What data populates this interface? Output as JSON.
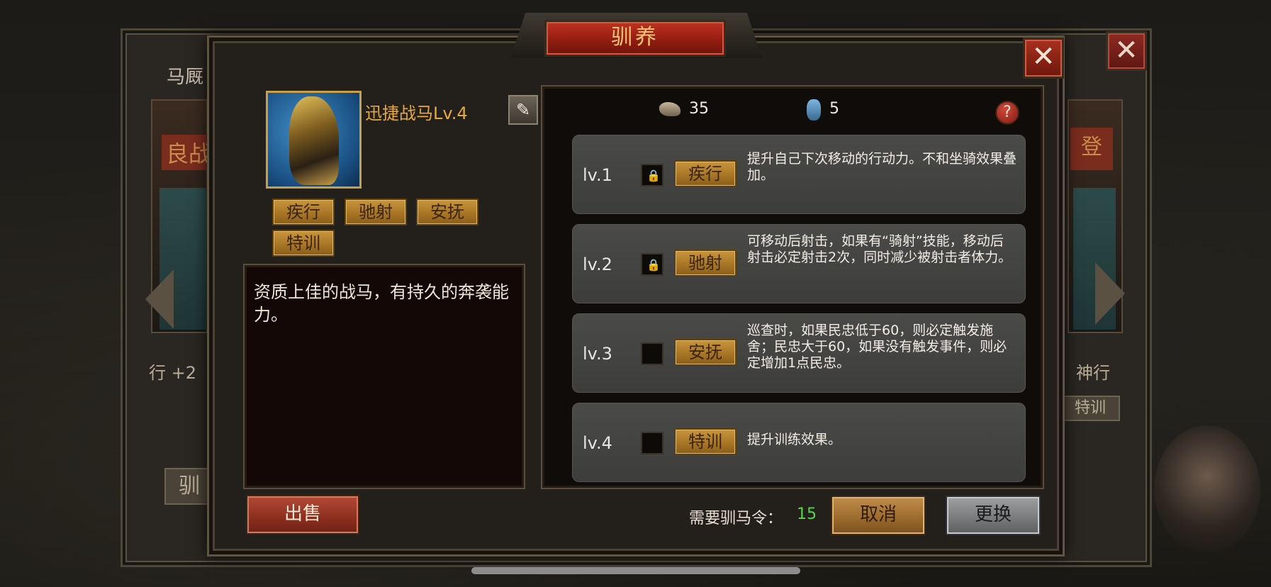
{
  "background": {
    "stable_title": "马厩",
    "left_card_label": "良战",
    "left_card_stat": "行 +2",
    "left_card_button": "驯",
    "right_card_label": "登",
    "right_card_stat": "神行",
    "right_card_button": "特训"
  },
  "dialog": {
    "title": "驯养",
    "close_glyph": "✕"
  },
  "horse": {
    "name": "迅捷战马Lv.4",
    "skills": [
      "疾行",
      "驰射",
      "安抚",
      "特训"
    ],
    "description": "资质上佳的战马，有持久的奔袭能力。"
  },
  "resources": {
    "item1_value": "35",
    "item2_value": "5",
    "help_glyph": "?"
  },
  "levels": [
    {
      "level": "lv.1",
      "locked": true,
      "skill": "疾行",
      "desc": "提升自己下次移动的行动力。不和坐骑效果叠加。"
    },
    {
      "level": "lv.2",
      "locked": true,
      "skill": "驰射",
      "desc": "可移动后射击，如果有“骑射”技能，移动后射击必定射击2次，同时减少被射击者体力。"
    },
    {
      "level": "lv.3",
      "locked": false,
      "skill": "安抚",
      "desc": "巡查时，如果民忠低于60，则必定触发施舍；民忠大于60，如果没有触发事件，则必定增加1点民忠。"
    },
    {
      "level": "lv.4",
      "locked": false,
      "skill": "特训",
      "desc": "提升训练效果。"
    }
  ],
  "footer": {
    "sell_label": "出售",
    "required_label": "需要驯马令：",
    "required_value": "15",
    "cancel_label": "取消",
    "replace_label": "更换"
  }
}
